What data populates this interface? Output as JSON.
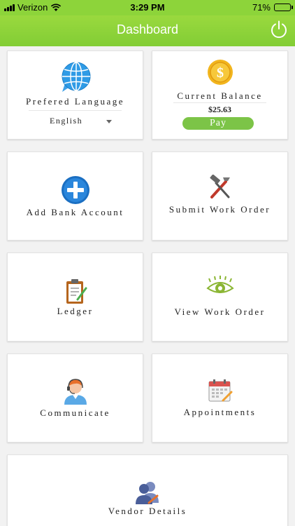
{
  "status_bar": {
    "carrier": "Verizon",
    "time": "3:29 PM",
    "battery_percent": "71%",
    "battery_level": 0.71
  },
  "nav": {
    "title": "Dashboard",
    "power_icon": "power-icon"
  },
  "tiles": {
    "language": {
      "label": "Prefered Language",
      "value": "English",
      "icon": "globe-chat-icon"
    },
    "balance": {
      "label": "Current Balance",
      "amount": "$25.63",
      "pay_label": "Pay",
      "icon": "dollar-coin-icon"
    },
    "add_bank": {
      "label": "Add Bank Account",
      "icon": "plus-circle-icon"
    },
    "submit_work_order": {
      "label": "Submit Work Order",
      "icon": "hammer-tools-icon"
    },
    "ledger": {
      "label": "Ledger",
      "icon": "clipboard-icon"
    },
    "view_work_order": {
      "label": "View Work Order",
      "icon": "eye-icon"
    },
    "communicate": {
      "label": "Communicate",
      "icon": "support-agent-icon"
    },
    "appointments": {
      "label": "Appointments",
      "icon": "calendar-icon"
    },
    "vendor_details": {
      "label": "Vendor Details",
      "icon": "vendor-users-icon"
    }
  },
  "colors": {
    "accent": "#8dd43a",
    "pay_button": "#7cc447"
  }
}
